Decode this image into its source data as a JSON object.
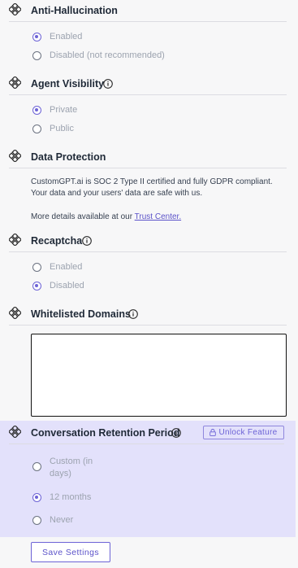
{
  "anti_hallucination": {
    "title": "Anti-Hallucination",
    "options": [
      {
        "label": "Enabled",
        "checked": true
      },
      {
        "label": "Disabled (not recommended)",
        "checked": false
      }
    ]
  },
  "agent_visibility": {
    "title": "Agent Visibility",
    "options": [
      {
        "label": "Private",
        "checked": true
      },
      {
        "label": "Public",
        "checked": false
      }
    ]
  },
  "data_protection": {
    "title": "Data Protection",
    "line1": "CustomGPT.ai is SOC 2 Type II certified and fully GDPR compliant.",
    "line2": "Your data and your users' data are safe with us.",
    "details_prefix": "More details available at our ",
    "trust_link": "Trust Center."
  },
  "recaptcha": {
    "title": "Recaptcha",
    "options": [
      {
        "label": "Enabled",
        "checked": false
      },
      {
        "label": "Disabled",
        "checked": true
      }
    ]
  },
  "whitelisted_domains": {
    "title": "Whitelisted Domains",
    "value": ""
  },
  "retention": {
    "title": "Conversation Retention Period",
    "unlock_label": "Unlock Feature",
    "options": [
      {
        "label_line1": "Custom (in",
        "label_line2": "days)",
        "checked": false
      },
      {
        "label": "12 months",
        "checked": true
      },
      {
        "label": "Never",
        "checked": false
      }
    ]
  },
  "save_label": "Save Settings",
  "colors": {
    "accent": "#6d63d6",
    "locked_bg": "#e3e1fb",
    "page_bg": "#f7f7f8"
  },
  "icons": {
    "section": "drag-move-icon",
    "info": "info-icon",
    "lock": "lock-icon"
  }
}
